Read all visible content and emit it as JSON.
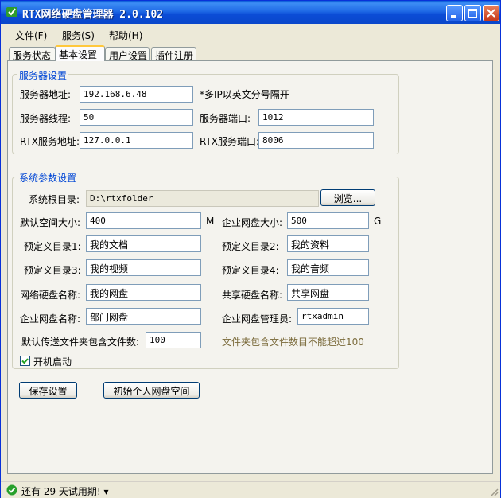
{
  "window": {
    "title": "RTX网络硬盘管理器 2.0.102"
  },
  "menu": [
    {
      "label": "文件(F)"
    },
    {
      "label": "服务(S)"
    },
    {
      "label": "帮助(H)"
    }
  ],
  "tabs": [
    {
      "label": "服务状态"
    },
    {
      "label": "基本设置",
      "active": true
    },
    {
      "label": "用户设置"
    },
    {
      "label": "插件注册"
    }
  ],
  "server_group": {
    "legend": "服务器设置",
    "address_label": "服务器地址:",
    "address_value": "192.168.6.48",
    "multi_ip_hint": "*多IP以英文分号隔开",
    "threads_label": "服务器线程:",
    "threads_value": "50",
    "port_label": "服务器端口:",
    "port_value": "1012",
    "rtx_address_label": "RTX服务地址:",
    "rtx_address_value": "127.0.0.1",
    "rtx_port_label": "RTX服务端口:",
    "rtx_port_value": "8006"
  },
  "system_group": {
    "legend": "系统参数设置",
    "root_dir_label": "系统根目录:",
    "root_dir_value": "D:\\rtxfolder",
    "browse_label": "浏览...",
    "default_space_label": "默认空间大小:",
    "default_space_value": "400",
    "default_space_unit": "M",
    "ent_disk_size_label": "企业网盘大小:",
    "ent_disk_size_value": "500",
    "ent_disk_size_unit": "G",
    "dir1_label": "预定义目录1:",
    "dir1_value": "我的文档",
    "dir2_label": "预定义目录2:",
    "dir2_value": "我的资料",
    "dir3_label": "预定义目录3:",
    "dir3_value": "我的视频",
    "dir4_label": "预定义目录4:",
    "dir4_value": "我的音频",
    "net_disk_name_label": "网络硬盘名称:",
    "net_disk_name_value": "我的网盘",
    "share_disk_name_label": "共享硬盘名称:",
    "share_disk_name_value": "共享网盘",
    "ent_disk_name_label": "企业网盘名称:",
    "ent_disk_name_value": "部门网盘",
    "ent_admin_label": "企业网盘管理员:",
    "ent_admin_value": "rtxadmin",
    "max_files_label": "默认传送文件夹包含文件数:",
    "max_files_value": "100",
    "max_files_hint": "文件夹包含文件数目不能超过100",
    "autostart_label": "开机启动",
    "autostart_checked": true
  },
  "buttons": {
    "save": "保存设置",
    "init_space": "初始个人网盘空间"
  },
  "status": {
    "text": "还有 29 天试用期! ▾"
  }
}
